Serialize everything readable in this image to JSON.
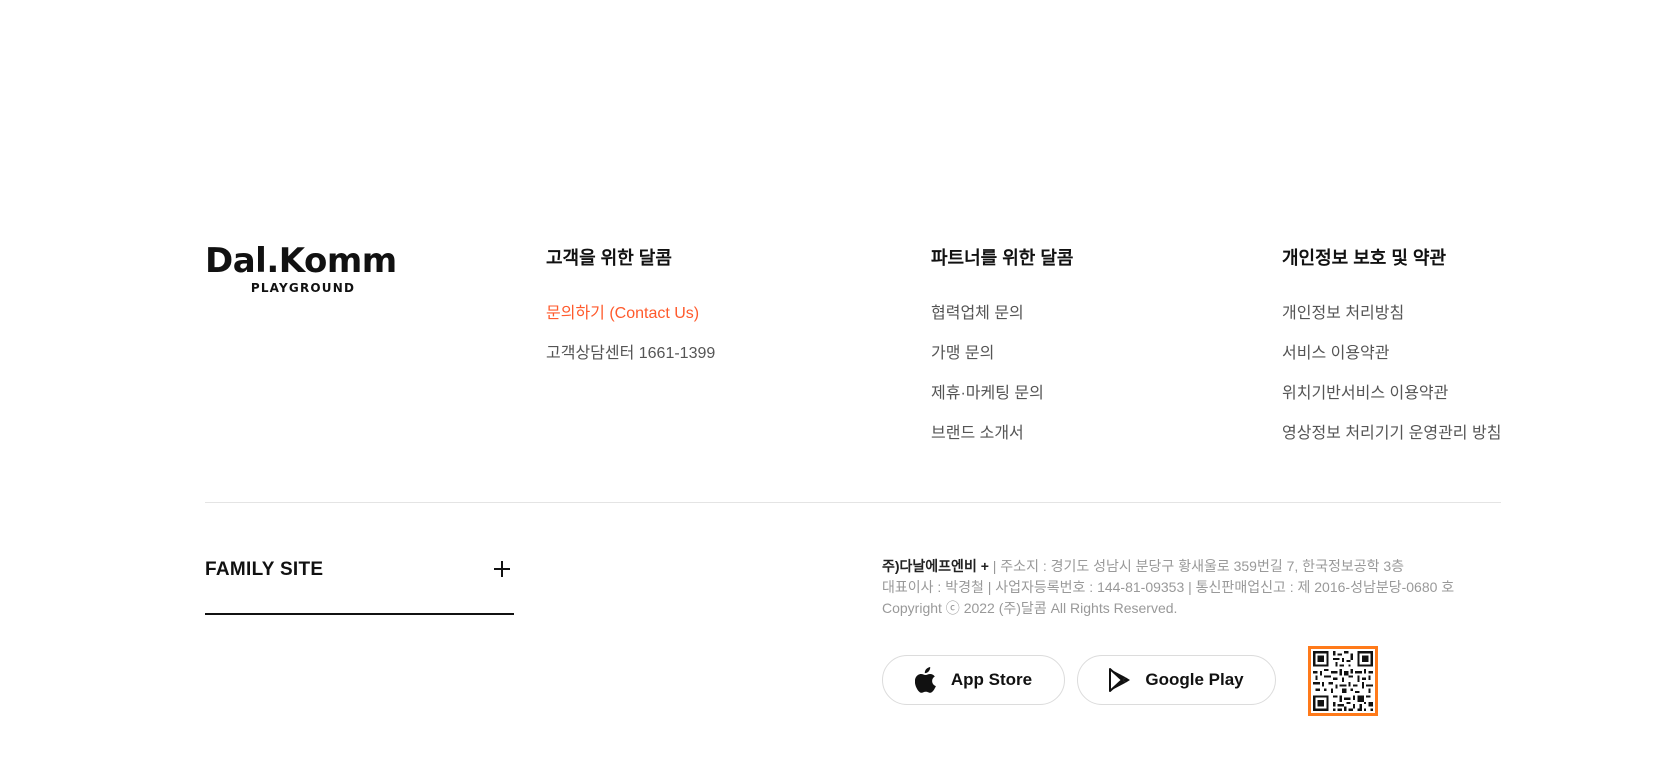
{
  "logo": {
    "main": "Dal.Komm",
    "sub": "PLAYGROUND"
  },
  "columns": [
    {
      "title": "고객을 위한 달콤",
      "links": [
        {
          "label": "문의하기 (Contact Us)",
          "accent": true
        },
        {
          "label": "고객상담센터 1661-1399",
          "accent": false
        }
      ]
    },
    {
      "title": "파트너를 위한 달콤",
      "links": [
        {
          "label": "협력업체 문의"
        },
        {
          "label": "가맹 문의"
        },
        {
          "label": "제휴·마케팅 문의"
        },
        {
          "label": "브랜드 소개서"
        }
      ]
    },
    {
      "title": "개인정보 보호 및 약관",
      "links": [
        {
          "label": "개인정보 처리방침"
        },
        {
          "label": "서비스 이용약관"
        },
        {
          "label": "위치기반서비스 이용약관"
        },
        {
          "label": "영상정보 처리기기 운영관리 방침"
        }
      ]
    }
  ],
  "family_site": {
    "label": "FAMILY SITE",
    "icon": "plus-icon"
  },
  "company": {
    "name": "주)다날에프엔비 +",
    "address": " | 주소지 : 경기도 성남시 분당구 황새울로 359번길 7, 한국정보공학 3층",
    "registration": "대표이사 : 박경철 | 사업자등록번호 : 144-81-09353 | 통신판매업신고 : 제 2016-성남분당-0680 호",
    "copyright": "Copyright ⓒ 2022 (주)달콤 All Rights Reserved."
  },
  "apps": {
    "app_store": {
      "label": "App Store",
      "icon": "apple-icon"
    },
    "google_play": {
      "label": "Google Play",
      "icon": "google-play-icon"
    }
  },
  "qr": {
    "icon": "qr-code-icon",
    "border_color": "#ff7a1a"
  },
  "colors": {
    "accent": "#ff5a2c",
    "text_dark": "#111111",
    "text_muted": "#999999"
  }
}
